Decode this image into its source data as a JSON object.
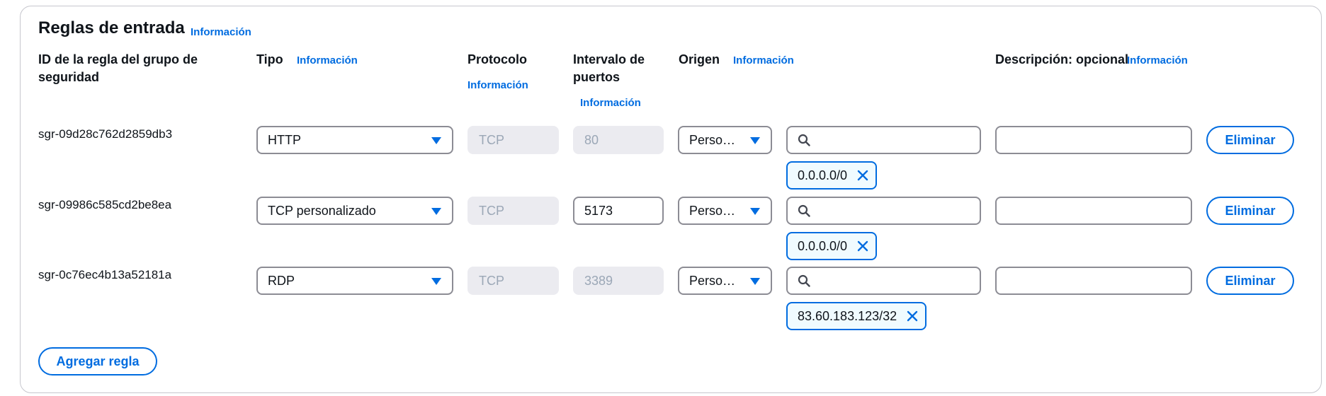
{
  "section": {
    "title": "Reglas de entrada",
    "info_link": "Información"
  },
  "columns": {
    "rule_id": "ID de la regla del grupo de seguridad",
    "type": "Tipo",
    "type_info": "Información",
    "protocol": "Protocolo",
    "protocol_info": "Información",
    "port_range": "Intervalo de puertos",
    "port_range_info": "Información",
    "source": "Origen",
    "source_info": "Información",
    "description": "Descripción: opcional",
    "description_info": "Información"
  },
  "rules": [
    {
      "id": "sgr-09d28c762d2859db3",
      "type": "HTTP",
      "protocol": "TCP",
      "port": "80",
      "port_editable": false,
      "source_type": "Perso…",
      "search_value": "",
      "token": "0.0.0.0/0",
      "description": "",
      "delete_label": "Eliminar"
    },
    {
      "id": "sgr-09986c585cd2be8ea",
      "type": "TCP personalizado",
      "protocol": "TCP",
      "port": "5173",
      "port_editable": true,
      "source_type": "Perso…",
      "search_value": "",
      "token": "0.0.0.0/0",
      "description": "",
      "delete_label": "Eliminar"
    },
    {
      "id": "sgr-0c76ec4b13a52181a",
      "type": "RDP",
      "protocol": "TCP",
      "port": "3389",
      "port_editable": false,
      "source_type": "Perso…",
      "search_value": "",
      "token": "83.60.183.123/32",
      "description": "",
      "delete_label": "Eliminar"
    }
  ],
  "add_rule_label": "Agregar regla",
  "colors": {
    "accent": "#006ce0",
    "border": "#8c8c94",
    "disabled_bg": "#ebebf0",
    "disabled_text": "#9ba7b6",
    "token_bg": "#f0fbff"
  },
  "icons": {
    "caret": "caret-down-icon",
    "search": "search-icon",
    "dismiss": "close-icon"
  }
}
